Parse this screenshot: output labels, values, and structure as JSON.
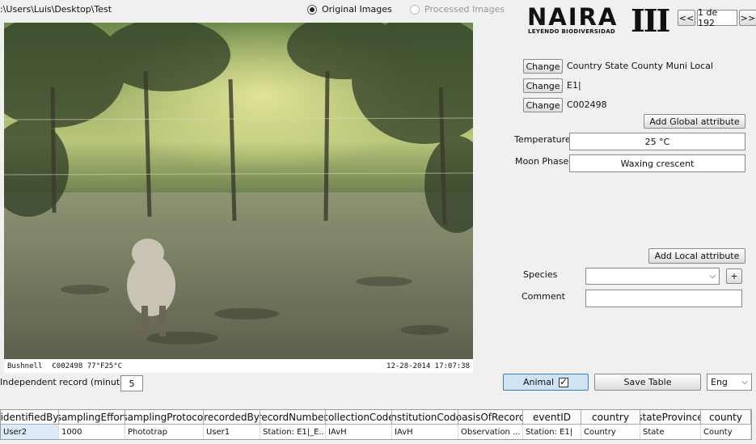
{
  "path": ":\\Users\\Luis\\Desktop\\Test",
  "view_mode": {
    "original_label": "Original Images",
    "processed_label": "Processed Images",
    "selected": "original"
  },
  "logo": {
    "name": "NAIRA",
    "roman": "III",
    "tagline": "LEYENDO BIODIVERSIDAD"
  },
  "pager": {
    "prev_label": "<<",
    "counter": "1 de 192",
    "next_label": ">>"
  },
  "fields": [
    {
      "button": "Change",
      "value": "Country State County Muni Local"
    },
    {
      "button": "Change",
      "value": "E1|"
    },
    {
      "button": "Change",
      "value": "C002498"
    }
  ],
  "global_attr_button": "Add Global attribute",
  "temperature": {
    "label": "Temperature",
    "value": "25 °C"
  },
  "moon_phase": {
    "label": "Moon Phase",
    "value": "Waxing crescent"
  },
  "local_attr_button": "Add Local attribute",
  "species": {
    "label": "Species",
    "value": "",
    "add_label": "+"
  },
  "comment": {
    "label": "Comment",
    "value": ""
  },
  "photo_bar": {
    "camera": "Bushnell",
    "info": "C002498   77°F25°C",
    "datetime": "12-28-2014  17:07:38"
  },
  "independent": {
    "label": "Independent record (minutes):",
    "value": "5"
  },
  "animal_button": {
    "label": "Animal",
    "checked": true
  },
  "save_button": "Save Table",
  "language": "Eng",
  "table": {
    "columns": [
      "identifiedBy",
      "samplingEffort",
      "samplingProtocol",
      "recordedBy",
      "recordNumber",
      "collectionCode",
      "institutionCode",
      "basisOfRecord",
      "eventID",
      "country",
      "stateProvince",
      "county"
    ],
    "rows": [
      [
        "User2",
        "1000",
        "Phototrap",
        "User1",
        "Station: E1|_E...",
        "IAvH",
        "IAvH",
        "Observation ...",
        "Station: E1|",
        "Country",
        "State",
        "County"
      ]
    ]
  },
  "colors": {
    "accent_border": "#3c7fb1",
    "animal_bg": "#cfe3f5"
  }
}
